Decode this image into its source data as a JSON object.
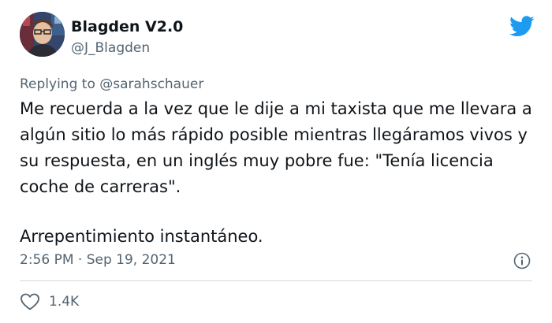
{
  "author": {
    "name": "Blagden V2.0",
    "handle": "@J_Blagden",
    "avatar_icon": "profile-photo"
  },
  "brand": {
    "icon": "twitter-bird-icon",
    "color": "#1d9bf0"
  },
  "reply": {
    "prefix": "Replying to ",
    "mention": "@sarahschauer"
  },
  "tweet": {
    "paragraph_1": "Me recuerda a la vez que le dije a mi taxista que me llevara a algún sitio lo más rápido posible mientras llegáramos vivos y su respuesta, en un inglés muy pobre fue: \"Tenía licencia coche de carreras\".",
    "paragraph_2": "Arrepentimiento instantáneo."
  },
  "meta": {
    "timestamp": "2:56 PM · Sep 19, 2021",
    "info_icon": "info-icon"
  },
  "engagement": {
    "like_icon": "heart-icon",
    "likes": "1.4K"
  },
  "colors": {
    "text_primary": "#0f1419",
    "text_secondary": "#536471",
    "divider": "#cfd9de"
  }
}
